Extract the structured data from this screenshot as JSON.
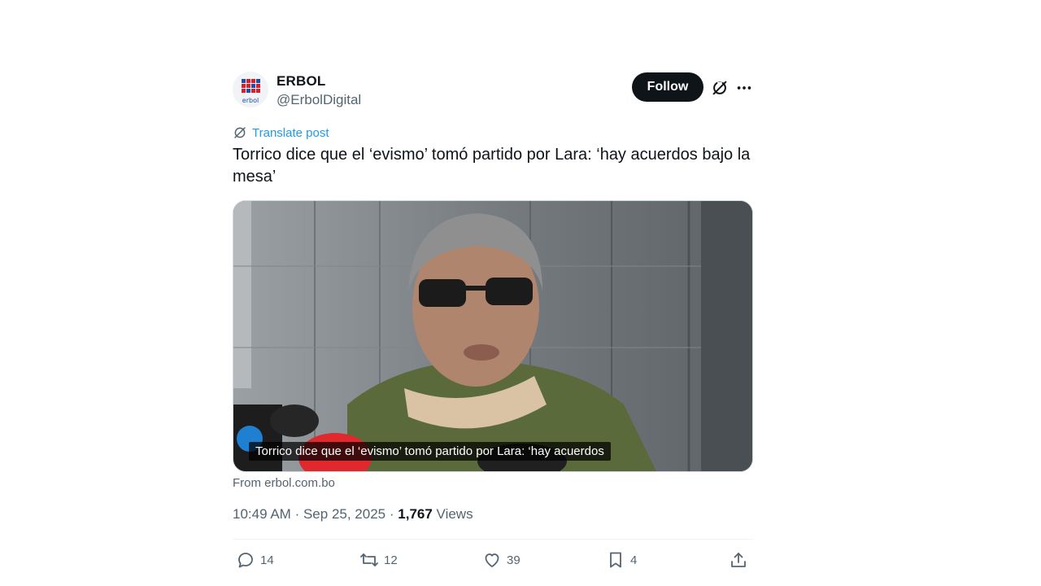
{
  "author": {
    "name": "ERBOL",
    "handle": "@ErbolDigital",
    "avatar_text": "erbol"
  },
  "header": {
    "follow_label": "Follow"
  },
  "translate_label": "Translate post",
  "tweet_text": "Torrico dice que el ‘evismo’ tomó partido por Lara: ‘hay acuerdos bajo la mesa’",
  "media": {
    "caption": "Torrico dice que el ‘evismo’ tomó partido por Lara: ‘hay acuerdos"
  },
  "source": "From erbol.com.bo",
  "meta": {
    "time": "10:49 AM",
    "date": "Sep 25, 2025",
    "sep": "·",
    "views_count": "1,767",
    "views_label": "Views"
  },
  "actions": {
    "replies": "14",
    "reposts": "12",
    "likes": "39",
    "bookmarks": "4"
  },
  "colors": {
    "accent": "#1d9bf0",
    "brand_red": "#d6202e",
    "text_primary": "#0f1419",
    "text_secondary": "#536471"
  }
}
